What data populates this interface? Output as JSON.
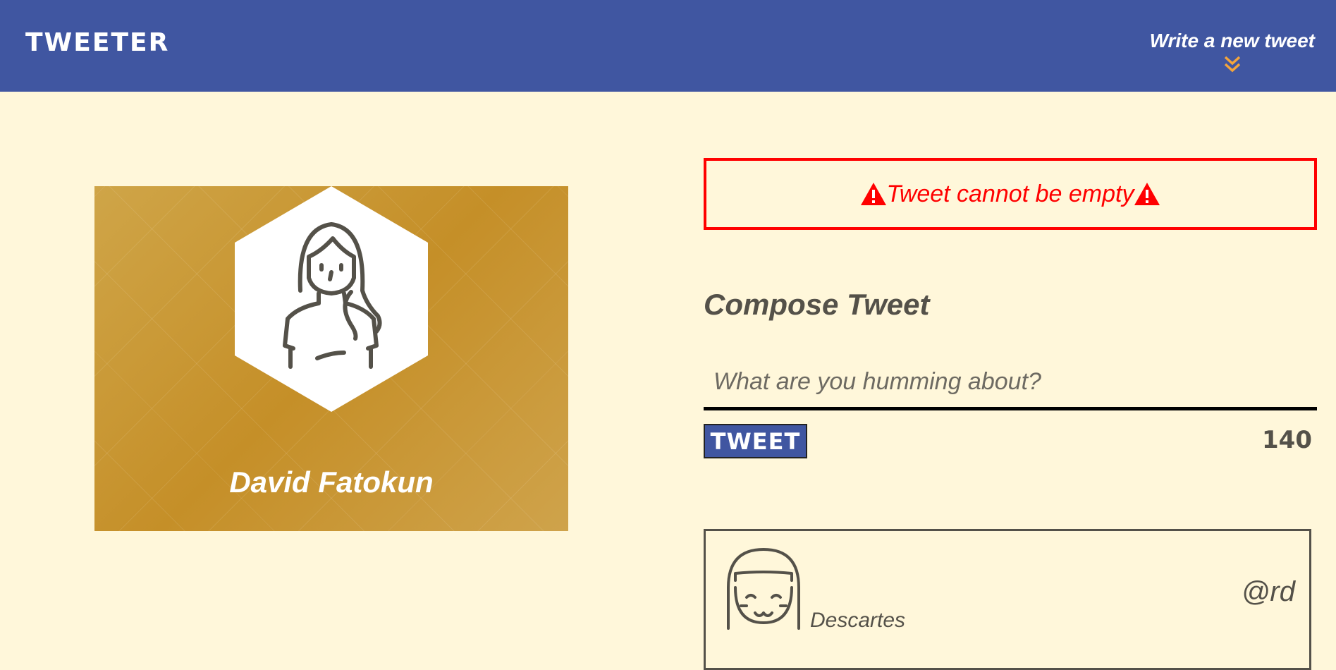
{
  "navbar": {
    "brand": "TWEETER",
    "write_link": "Write a new tweet",
    "write_icon": "double-chevron-down-icon"
  },
  "profile": {
    "name": "David Fatokun",
    "avatar_icon": "user-avatar-icon"
  },
  "error": {
    "message": "Tweet cannot be empty",
    "icon": "warning-icon"
  },
  "compose": {
    "title": "Compose Tweet",
    "placeholder": "What are you humming about?",
    "button_label": "TWEET",
    "counter": "140"
  },
  "tweet": {
    "author_name": "Descartes",
    "handle": "@rd",
    "avatar_icon": "user-avatar-icon"
  },
  "colors": {
    "navbar": "#4056a1",
    "background": "#fff7da",
    "accent": "#f4a53b",
    "error": "#ff0000",
    "text": "#545149",
    "card": "#c99a37"
  }
}
